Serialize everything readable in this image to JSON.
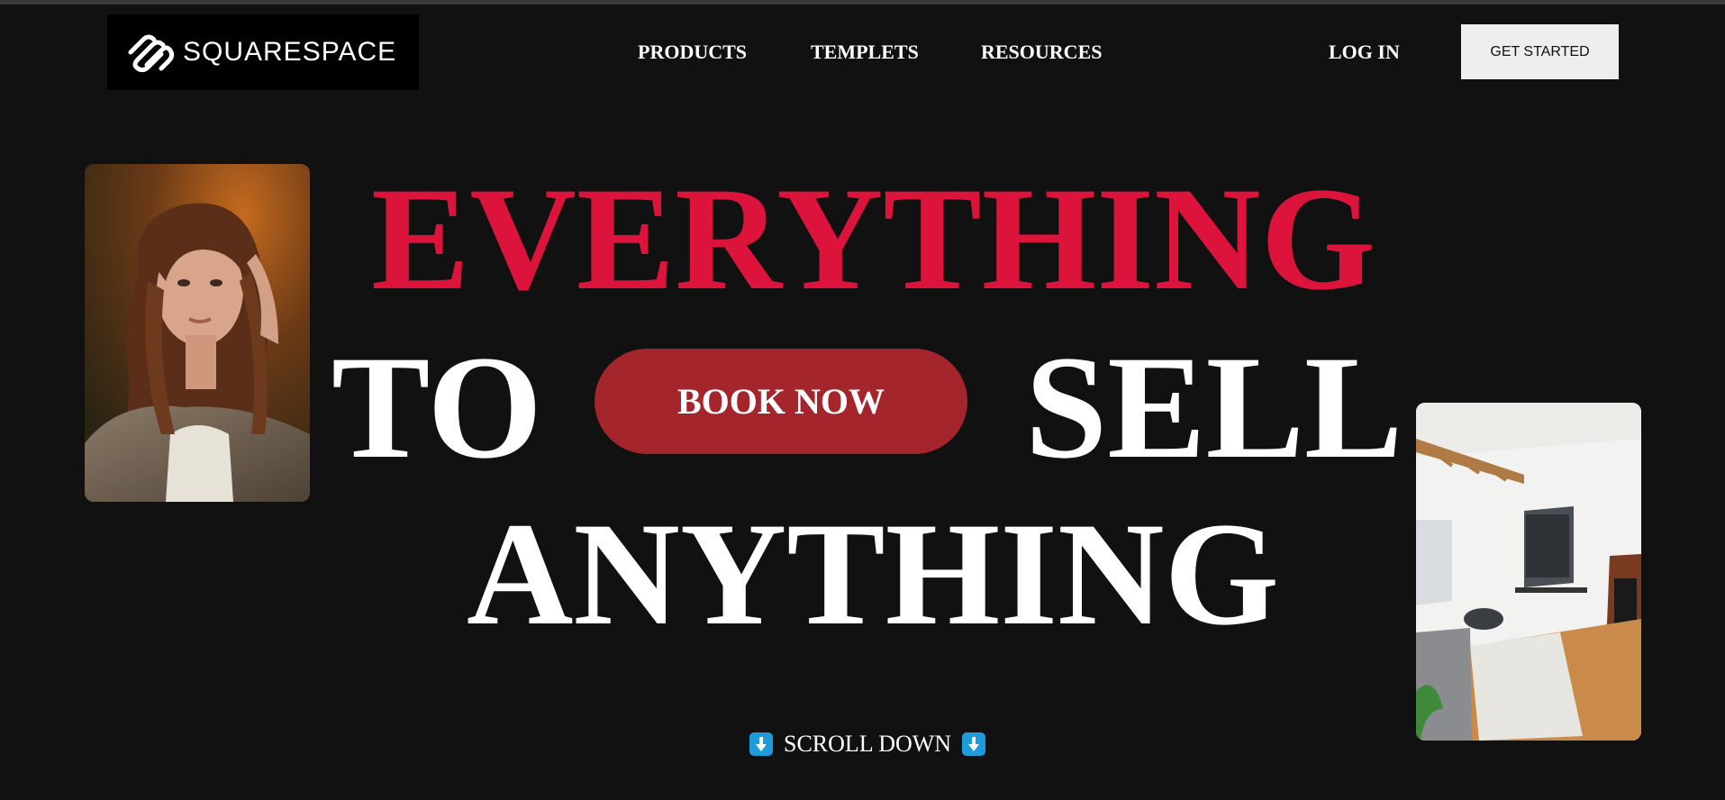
{
  "brand": {
    "name": "SQUARESPACE",
    "logo_icon": "squarespace-logo-icon"
  },
  "nav": {
    "items": [
      {
        "label": "PRODUCTS"
      },
      {
        "label": "TEMPLETS"
      },
      {
        "label": "RESOURCES"
      }
    ],
    "login_label": "LOG IN",
    "cta_label": "GET STARTED"
  },
  "hero": {
    "line1": "EVERYTHING",
    "line2_left": "TO",
    "line2_right": "SELL",
    "line3": "ANYTHING",
    "book_label": "BOOK NOW",
    "scroll_label": "SCROLL DOWN",
    "scroll_icon": "down-arrow-icon"
  },
  "colors": {
    "background": "#111111",
    "accent_red": "#dc143c",
    "button_red": "#a4262c",
    "cta_bg": "#eeeeee",
    "arrow_blue": "#1e9bdb"
  },
  "images": [
    {
      "subject": "portrait-woman-photo"
    },
    {
      "subject": "living-room-photo"
    }
  ]
}
